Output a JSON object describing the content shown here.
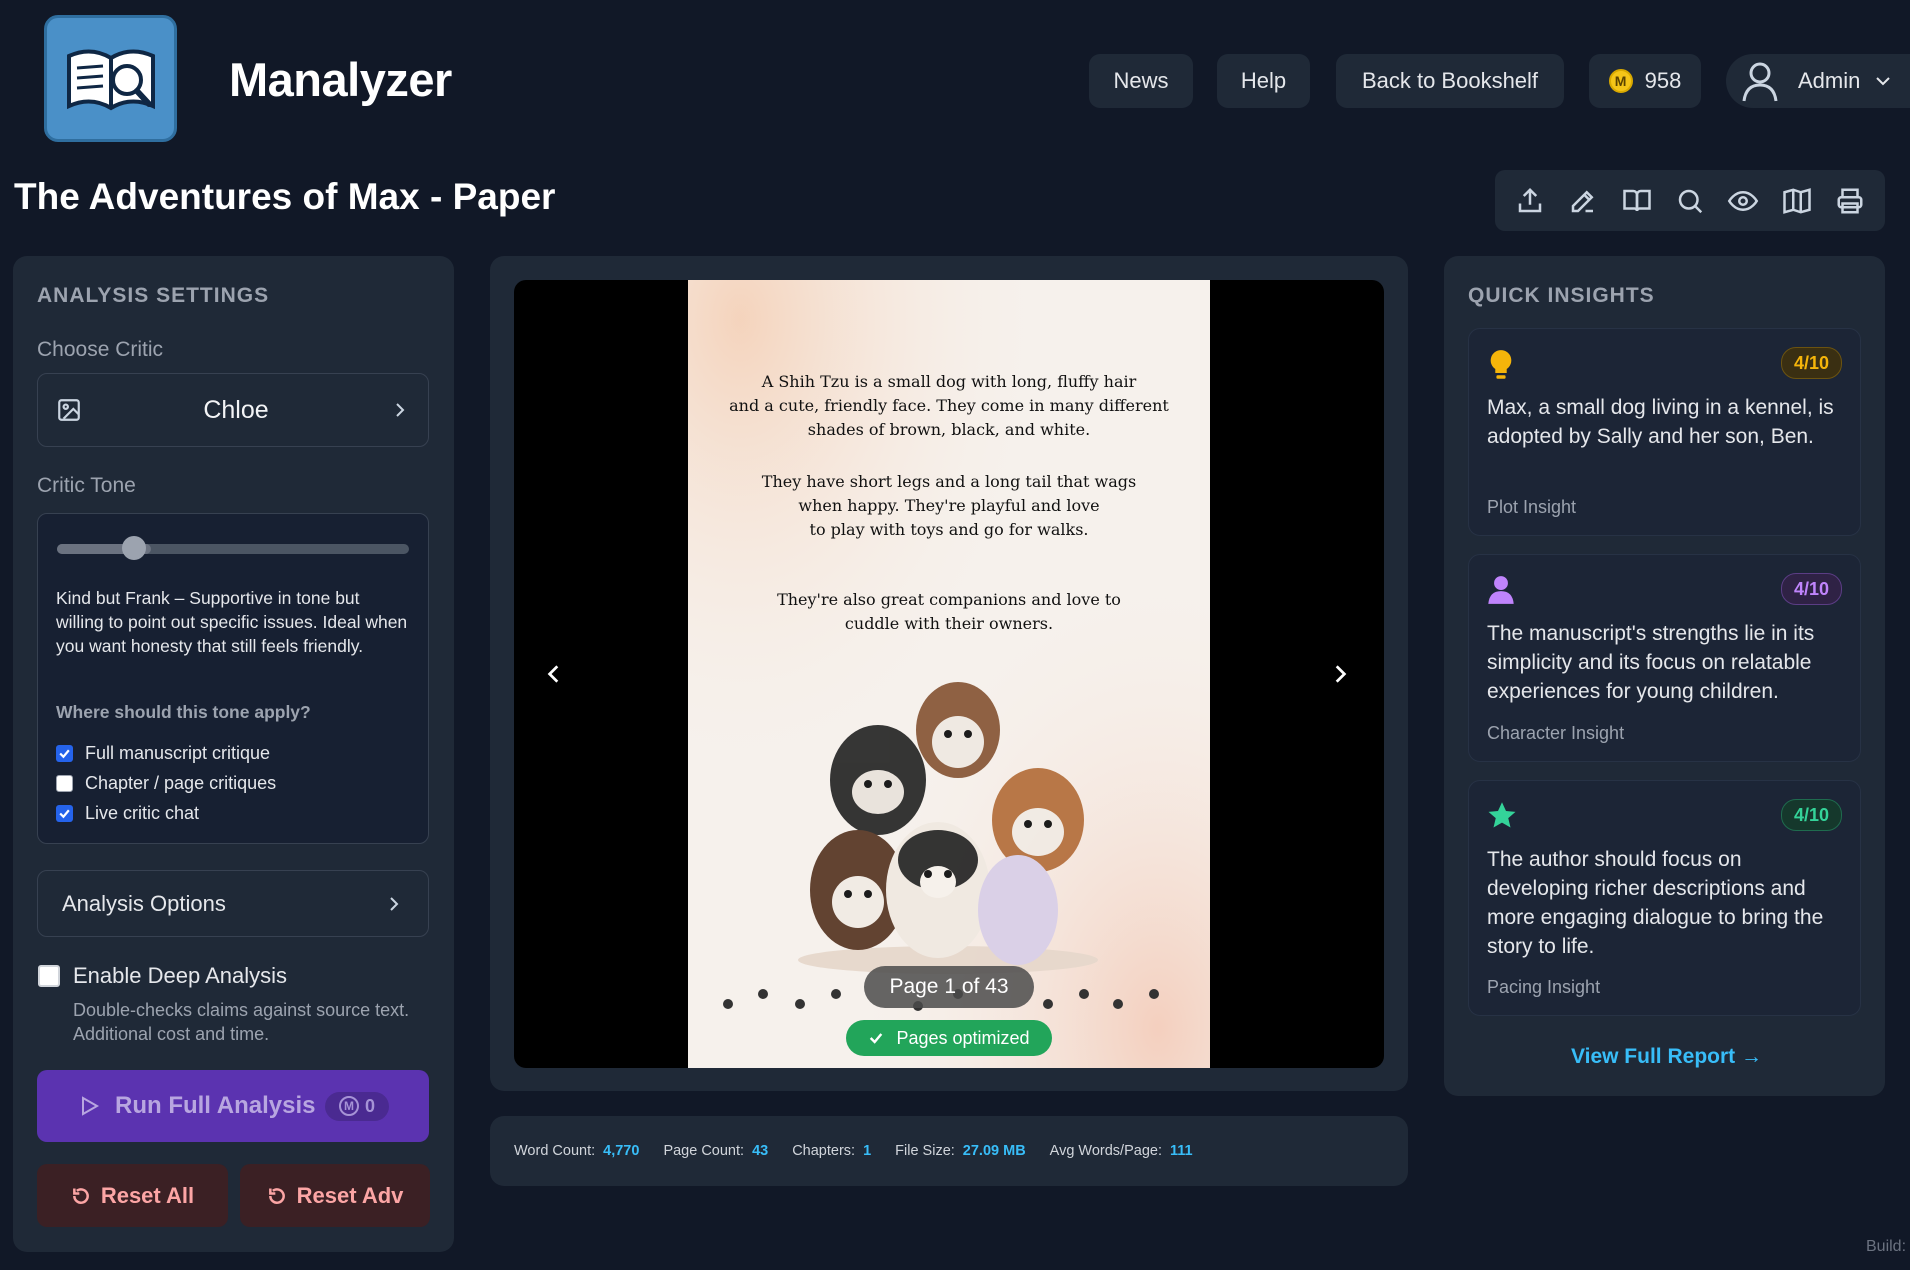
{
  "app": {
    "title": "Manalyzer"
  },
  "header": {
    "nav": {
      "news": "News",
      "help": "Help",
      "back": "Back to Bookshelf"
    },
    "credits": {
      "symbol": "M",
      "value": "958"
    },
    "user": {
      "name": "Admin"
    }
  },
  "document": {
    "title": "The Adventures of Max - Paper"
  },
  "toolbar": {
    "icons": [
      "upload-icon",
      "edit-icon",
      "book-open-icon",
      "search-icon",
      "eye-icon",
      "map-icon",
      "printer-icon"
    ]
  },
  "settings": {
    "title": "ANALYSIS SETTINGS",
    "critic_label": "Choose Critic",
    "critic_value": "Chloe",
    "tone_label": "Critic Tone",
    "tone_level": 0.25,
    "tone_description": "Kind but Frank – Supportive in tone but willing to point out specific issues. Ideal when you want honesty that still feels friendly.",
    "tone_question": "Where should this tone apply?",
    "scopes": [
      {
        "label": "Full manuscript critique",
        "checked": true
      },
      {
        "label": "Chapter / page critiques",
        "checked": false
      },
      {
        "label": "Live critic chat",
        "checked": true
      }
    ],
    "analysis_options_label": "Analysis Options",
    "deep_analysis": {
      "label": "Enable Deep Analysis",
      "checked": false,
      "help": "Double-checks claims against source text. Additional cost and time."
    },
    "run_button": {
      "label": "Run Full Analysis",
      "cost_symbol": "M",
      "cost": "0"
    },
    "reset_all": "Reset All",
    "reset_adv": "Reset Adv"
  },
  "viewer": {
    "page_text": [
      [
        "A Shih Tzu is a small dog with long, fluffy hair",
        "and a cute, friendly face. They come in many different",
        "shades of brown, black, and white."
      ],
      [
        "They have short legs and a long tail that wags",
        "when happy. They're playful and love",
        "to play with toys and go for walks."
      ],
      [
        "They're also great companions and love to",
        "cuddle with their owners."
      ]
    ],
    "page_indicator": "Page 1 of 43",
    "optimized_label": "Pages optimized"
  },
  "stats": [
    {
      "label": "Word Count:",
      "value": "4,770"
    },
    {
      "label": "Page Count:",
      "value": "43"
    },
    {
      "label": "Chapters:",
      "value": "1"
    },
    {
      "label": "File Size:",
      "value": "27.09 MB"
    },
    {
      "label": "Avg Words/Page:",
      "value": "111"
    }
  ],
  "insights": {
    "title": "QUICK INSIGHTS",
    "cards": [
      {
        "icon": "lightbulb-icon",
        "score": "4/10",
        "text": "Max, a small dog living in a kennel, is adopted by Sally and her son, Ben.",
        "category": "Plot Insight",
        "color": "#f5b50a"
      },
      {
        "icon": "user-icon",
        "score": "4/10",
        "text": "The manuscript's strengths lie in its simplicity and its focus on relatable experiences for young children.",
        "category": "Character Insight",
        "color": "#c084fc"
      },
      {
        "icon": "star-icon",
        "score": "4/10",
        "text": "The author should focus on developing richer descriptions and more engaging dialogue to bring the story to life.",
        "category": "Pacing Insight",
        "color": "#34d399"
      }
    ],
    "report_link": "View Full Report →"
  },
  "footer": {
    "build": "Build:"
  },
  "colors": {
    "background": "#111827",
    "panel": "#1f2937",
    "accent": "#38bdf8",
    "primary": "#5b33b0",
    "success": "#22a55a",
    "danger": "#fca5a5"
  }
}
